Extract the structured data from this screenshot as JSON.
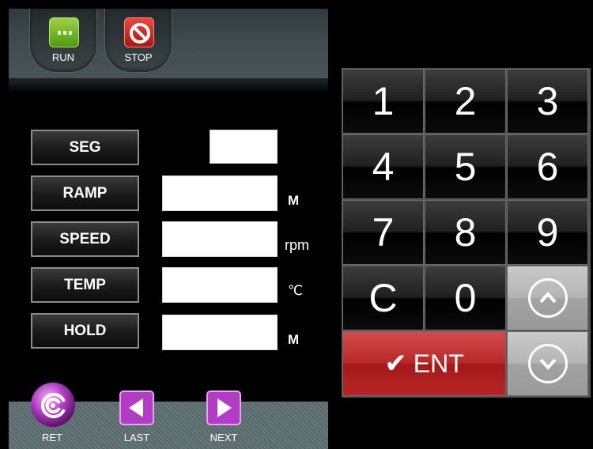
{
  "top_bar": {
    "run_label": "RUN",
    "stop_label": "STOP"
  },
  "params": [
    {
      "label": "SEG",
      "unit": ""
    },
    {
      "label": "RAMP",
      "unit": "M"
    },
    {
      "label": "SPEED",
      "unit": "rpm"
    },
    {
      "label": "TEMP",
      "unit": "℃"
    },
    {
      "label": "HOLD",
      "unit": "M"
    }
  ],
  "nav": {
    "ret_label": "RET",
    "last_label": "LAST",
    "next_label": "NEXT"
  },
  "keypad": {
    "k1": "1",
    "k2": "2",
    "k3": "3",
    "k4": "4",
    "k5": "5",
    "k6": "6",
    "k7": "7",
    "k8": "8",
    "k9": "9",
    "clear": "C",
    "k0": "0",
    "enter": "ENT"
  },
  "icons": {
    "run": "run-icon",
    "stop": "stop-icon",
    "ret": "return-icon",
    "last": "left-arrow-icon",
    "next": "right-arrow-icon",
    "up": "up-arrow-icon",
    "down": "down-arrow-icon",
    "check": "checkmark-icon"
  },
  "colors": {
    "run_green": "#6bb41f",
    "stop_red": "#d8241c",
    "enter_red": "#b82a2a",
    "nav_purple": "#b23cc4"
  }
}
